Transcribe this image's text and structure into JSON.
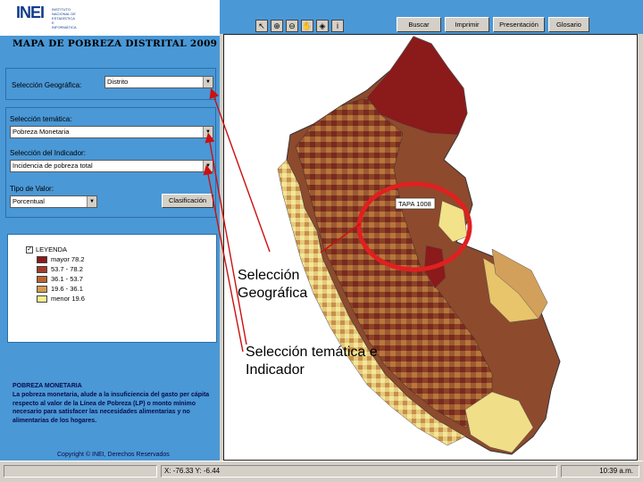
{
  "header": {
    "logo_text": "INEI",
    "logo_tagline": "INSTITUTO NACIONAL DE ESTADÍSTICA E INFORMÁTICA",
    "map_title": "MAPA DE POBREZA DISTRITAL 2009"
  },
  "controls": {
    "geo_label": "Selección Geográfica:",
    "geo_value": "Distrito",
    "theme_label": "Selección temática:",
    "theme_value": "Pobreza Monetaria",
    "indicator_label": "Selección del Indicador:",
    "indicator_value": "Incidencia de pobreza total",
    "value_type_label": "Tipo de Valor:",
    "value_type_value": "Porcentual",
    "classify_button": "Clasificación"
  },
  "toolbar": {
    "tools": [
      "pointer-icon",
      "zoom-in-icon",
      "zoom-out-icon",
      "pan-icon",
      "identify-icon",
      "info-icon"
    ],
    "search_button": "Buscar",
    "print_button": "Imprimir",
    "presentation_button": "Presentación",
    "glossary_button": "Glosario"
  },
  "legend": {
    "title": "LEYENDA",
    "items": [
      {
        "label": "mayor 78.2",
        "color": "#8b1a1a"
      },
      {
        "label": "53.7 - 78.2",
        "color": "#a33a2a"
      },
      {
        "label": "36.1 - 53.7",
        "color": "#b8652e"
      },
      {
        "label": "19.6 - 36.1",
        "color": "#d49a52"
      },
      {
        "label": "menor 19.6",
        "color": "#f6ee8e"
      }
    ]
  },
  "info": {
    "heading": "POBREZA MONETARIA",
    "text": "La pobreza monetaria, alude a la insuficiencia del gasto per cápita respecto al valor de la Línea de Pobreza (LP) o monto mínimo necesario para satisfacer las necesidades alimentarias y no alimentarias de los hogares.",
    "copyright": "Copyright © INEI, Derechos Reservados"
  },
  "map": {
    "tooltip": "TAPA 1008",
    "annotation_geo": "Selección Geográfica",
    "annotation_theme": "Selección temática e Indicador"
  },
  "status": {
    "coords": "X: -76.33  Y: -6.44",
    "time": "10:39 a.m."
  },
  "colors": {
    "sidebar_bg": "#4a98d6",
    "circle": "#e02020",
    "arrow": "#cc1010"
  }
}
